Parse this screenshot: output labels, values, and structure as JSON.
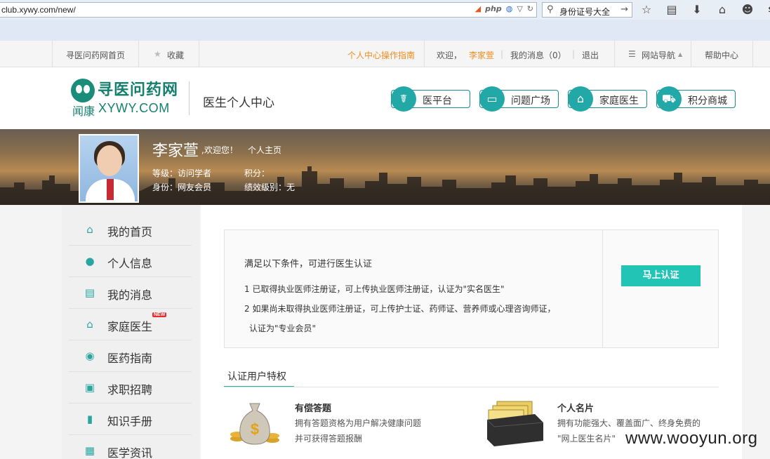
{
  "browser": {
    "url": "club.xywy.com/new/",
    "php_badge": "php",
    "search_value": "身份证号大全"
  },
  "topnav": {
    "home_link": "寻医问药网首页",
    "favorite": "收藏",
    "guide": "个人中心操作指南",
    "welcome": "欢迎，",
    "username": "李家萱",
    "messages": "我的消息（0）",
    "logout": "退出",
    "site_nav": "网站导航",
    "help": "帮助中心"
  },
  "header": {
    "logo_cn": "寻医问药网",
    "logo_sub_cn": "闻康",
    "logo_sub_en": "XYWY.COM",
    "title": "医生个人中心",
    "buttons": [
      {
        "label": "医平台"
      },
      {
        "label": "问题广场"
      },
      {
        "label": "家庭医生"
      },
      {
        "label": "积分商城"
      }
    ]
  },
  "banner": {
    "name": "李家萱",
    "welcome": ",欢迎您！",
    "homepage_link": "个人主页",
    "level": "等级：访问学者",
    "points": "积分：",
    "identity": "身份：网友会员",
    "performance": "绩效级别：无"
  },
  "sidebar": {
    "items": [
      {
        "label": "我的首页",
        "icon": "home-icon"
      },
      {
        "label": "个人信息",
        "icon": "user-icon"
      },
      {
        "label": "我的消息",
        "icon": "message-icon"
      },
      {
        "label": "家庭医生",
        "icon": "family-doctor-icon",
        "badge": "NEW"
      },
      {
        "label": "医药指南",
        "icon": "compass-icon"
      },
      {
        "label": "求职招聘",
        "icon": "card-icon"
      },
      {
        "label": "知识手册",
        "icon": "book-icon"
      },
      {
        "label": "医学资讯",
        "icon": "news-icon"
      }
    ]
  },
  "certification": {
    "title": "满足以下条件，可进行医生认证",
    "condition1": "1 已取得执业医师注册证，可上传执业医师注册证，认证为\"实名医生\"",
    "condition2": "2 如果尚未取得执业医师注册证，可上传护士证、药师证、营养师或心理咨询师证，",
    "condition2b": "认证为\"专业会员\"",
    "button": "马上认证"
  },
  "privileges": {
    "tab": "认证用户特权",
    "items": [
      {
        "title": "有偿答题",
        "desc1": "拥有答题资格为用户解决健康问题",
        "desc2": "并可获得答题报酬",
        "icon": "money-bag-icon"
      },
      {
        "title": "个人名片",
        "desc1": "拥有功能强大、覆盖面广、终身免费的",
        "desc2": "\"网上医生名片\"",
        "icon": "card-file-icon"
      }
    ]
  },
  "watermark": "www.wooyun.org",
  "colors": {
    "accent": "#22c4b6",
    "brand": "#16806e",
    "orange": "#f08c1e"
  }
}
